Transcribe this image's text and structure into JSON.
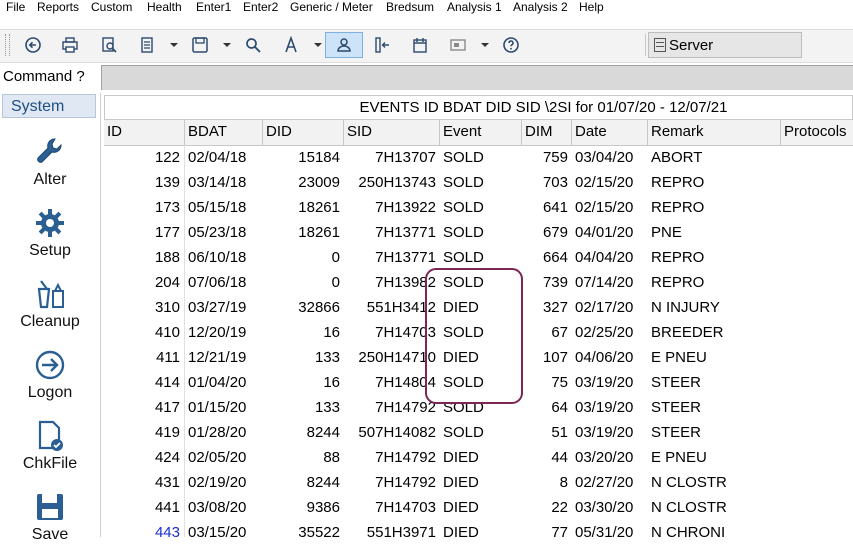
{
  "menu": [
    "File",
    "Reports",
    "Custom",
    "Health",
    "Enter1",
    "Enter2",
    "Generic / Meter",
    "Bredsum",
    "Analysis 1",
    "Analysis 2",
    "Help"
  ],
  "toolbar": {
    "buttons": [
      "back-icon",
      "print-icon",
      "print-preview-icon",
      "report-icon",
      "save-icon",
      "search-icon",
      "font-icon",
      "user-icon",
      "column-icon",
      "calendar-icon",
      "card-icon",
      "help-icon"
    ],
    "server_label": "Server"
  },
  "command": {
    "label": "Command ?",
    "value": ""
  },
  "sidebar": {
    "header": "System",
    "items": [
      {
        "label": "Alter",
        "icon": "wrench-icon"
      },
      {
        "label": "Setup",
        "icon": "gear-icon"
      },
      {
        "label": "Cleanup",
        "icon": "cleanup-icon"
      },
      {
        "label": "Logon",
        "icon": "logon-icon"
      },
      {
        "label": "ChkFile",
        "icon": "checkfile-icon"
      },
      {
        "label": "Save",
        "icon": "save-icon"
      }
    ]
  },
  "grid": {
    "title": "EVENTS  ID BDAT DID SID \\2SI for 01/07/20 - 12/07/21",
    "columns": [
      "ID",
      "BDAT",
      "DID",
      "SID",
      "Event",
      "DIM",
      "Date",
      "Remark",
      "Protocols"
    ],
    "rows": [
      [
        "122",
        "02/04/18",
        "15184",
        "7H13707",
        "SOLD",
        "759",
        "03/04/20",
        "ABORT"
      ],
      [
        "139",
        "03/14/18",
        "23009",
        "250H13743",
        "SOLD",
        "703",
        "02/15/20",
        "REPRO"
      ],
      [
        "173",
        "05/15/18",
        "18261",
        "7H13922",
        "SOLD",
        "641",
        "02/15/20",
        "REPRO"
      ],
      [
        "177",
        "05/23/18",
        "18261",
        "7H13771",
        "SOLD",
        "679",
        "04/01/20",
        "PNE"
      ],
      [
        "188",
        "06/10/18",
        "0",
        "7H13771",
        "SOLD",
        "664",
        "04/04/20",
        "REPRO"
      ],
      [
        "204",
        "07/06/18",
        "0",
        "7H13982",
        "SOLD",
        "739",
        "07/14/20",
        "REPRO"
      ],
      [
        "310",
        "03/27/19",
        "32866",
        "551H3412",
        "DIED",
        "327",
        "02/17/20",
        "N INJURY"
      ],
      [
        "410",
        "12/20/19",
        "16",
        "7H14703",
        "SOLD",
        "67",
        "02/25/20",
        "BREEDER"
      ],
      [
        "411",
        "12/21/19",
        "133",
        "250H14710",
        "DIED",
        "107",
        "04/06/20",
        "E PNEU"
      ],
      [
        "414",
        "01/04/20",
        "16",
        "7H14804",
        "SOLD",
        "75",
        "03/19/20",
        "STEER"
      ],
      [
        "417",
        "01/15/20",
        "133",
        "7H14792",
        "SOLD",
        "64",
        "03/19/20",
        "STEER"
      ],
      [
        "419",
        "01/28/20",
        "8244",
        "507H14082",
        "SOLD",
        "51",
        "03/19/20",
        "STEER"
      ],
      [
        "424",
        "02/05/20",
        "88",
        "7H14792",
        "DIED",
        "44",
        "03/20/20",
        "E PNEU"
      ],
      [
        "431",
        "02/19/20",
        "8244",
        "7H14792",
        "DIED",
        "8",
        "02/27/20",
        "N CLOSTR"
      ],
      [
        "441",
        "03/08/20",
        "9386",
        "7H14703",
        "DIED",
        "22",
        "03/30/20",
        "N CLOSTR"
      ],
      [
        "443",
        "03/15/20",
        "35522",
        "551H3971",
        "DIED",
        "77",
        "05/31/20",
        "N CHRONI"
      ]
    ]
  },
  "colors": {
    "highlight": "#7a2756",
    "link_id": "#1a2fd0",
    "sidebar_header": "#1f4f82"
  }
}
